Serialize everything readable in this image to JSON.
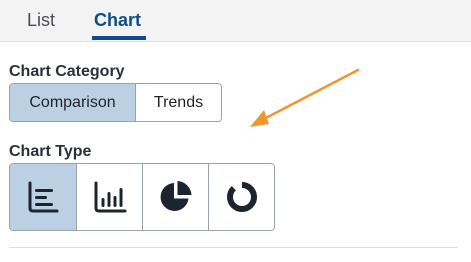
{
  "tabs": [
    {
      "label": "List",
      "active": false
    },
    {
      "label": "Chart",
      "active": true
    }
  ],
  "chart_category": {
    "label": "Chart Category",
    "options": [
      {
        "label": "Comparison",
        "selected": true
      },
      {
        "label": "Trends",
        "selected": false
      }
    ]
  },
  "chart_type": {
    "label": "Chart Type",
    "options": [
      {
        "icon": "bar-chart-horizontal-icon",
        "selected": true
      },
      {
        "icon": "bar-chart-vertical-icon",
        "selected": false
      },
      {
        "icon": "pie-chart-icon",
        "selected": false
      },
      {
        "icon": "donut-chart-icon",
        "selected": false
      }
    ]
  },
  "colors": {
    "accent": "#0b4f86",
    "selected_bg": "#bcd0e3",
    "annotation_arrow": "#f0962e"
  }
}
